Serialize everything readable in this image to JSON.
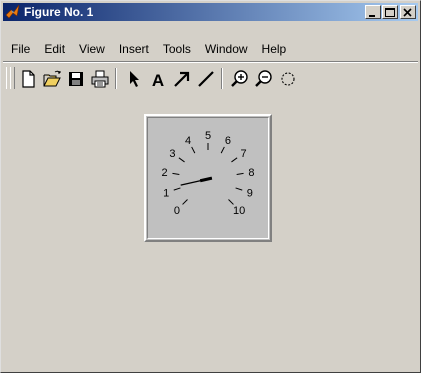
{
  "window": {
    "title": "Figure No. 1",
    "app_icon": "matlab-logo-icon",
    "controls": [
      "minimize-icon",
      "maximize-icon",
      "close-icon"
    ]
  },
  "menu": {
    "items": [
      {
        "label": "File"
      },
      {
        "label": "Edit"
      },
      {
        "label": "View"
      },
      {
        "label": "Insert"
      },
      {
        "label": "Tools"
      },
      {
        "label": "Window"
      },
      {
        "label": "Help"
      }
    ]
  },
  "toolbar": {
    "buttons": [
      "new-figure-icon",
      "open-file-icon",
      "save-icon",
      "print-icon",
      "select-arrow-icon",
      "insert-text-icon",
      "insert-arrow-icon",
      "insert-line-icon",
      "zoom-in-icon",
      "zoom-out-icon",
      "rotate-3d-icon"
    ],
    "text_tool_label": "A"
  },
  "gauge": {
    "min": 0,
    "max": 10,
    "tick_labels": [
      "0",
      "1",
      "2",
      "3",
      "4",
      "5",
      "6",
      "7",
      "8",
      "9",
      "10"
    ],
    "value": 1.2,
    "colors": {
      "face": "#c0c0c0",
      "needle": "#000000",
      "labels": "#000000"
    }
  }
}
